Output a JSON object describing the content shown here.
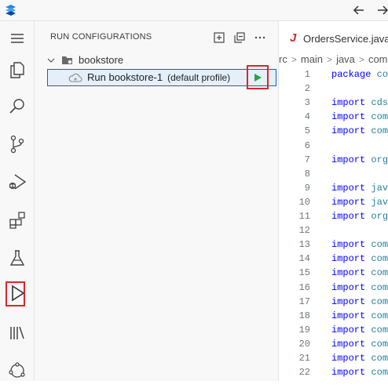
{
  "sidebar": {
    "title": "RUN CONFIGURATIONS",
    "group_label": "bookstore",
    "config_name": "Run bookstore-1",
    "config_profile": "(default profile)"
  },
  "editor": {
    "tab_icon": "J",
    "tab_label": "OrdersService.java",
    "breadcrumb": [
      "rc",
      "main",
      "java",
      "com"
    ],
    "lines": [
      {
        "num": "1",
        "kw": "package",
        "rest": "co"
      },
      {
        "num": "2",
        "kw": "",
        "rest": ""
      },
      {
        "num": "3",
        "kw": "import",
        "rest": "cds"
      },
      {
        "num": "4",
        "kw": "import",
        "rest": "com"
      },
      {
        "num": "5",
        "kw": "import",
        "rest": "com"
      },
      {
        "num": "6",
        "kw": "",
        "rest": ""
      },
      {
        "num": "7",
        "kw": "import",
        "rest": "org"
      },
      {
        "num": "8",
        "kw": "",
        "rest": ""
      },
      {
        "num": "9",
        "kw": "import",
        "rest": "jav"
      },
      {
        "num": "10",
        "kw": "import",
        "rest": "jav"
      },
      {
        "num": "11",
        "kw": "import",
        "rest": "org"
      },
      {
        "num": "12",
        "kw": "",
        "rest": ""
      },
      {
        "num": "13",
        "kw": "import",
        "rest": "com"
      },
      {
        "num": "14",
        "kw": "import",
        "rest": "com"
      },
      {
        "num": "15",
        "kw": "import",
        "rest": "com"
      },
      {
        "num": "16",
        "kw": "import",
        "rest": "com"
      },
      {
        "num": "17",
        "kw": "import",
        "rest": "com"
      },
      {
        "num": "18",
        "kw": "import",
        "rest": "com"
      },
      {
        "num": "19",
        "kw": "import",
        "rest": "com"
      },
      {
        "num": "20",
        "kw": "import",
        "rest": "com"
      },
      {
        "num": "21",
        "kw": "import",
        "rest": "com"
      },
      {
        "num": "22",
        "kw": "import",
        "rest": "com"
      }
    ]
  },
  "icons": {
    "accent": "#0a66c2",
    "highlight": "#d9262d",
    "play": "#2ea043"
  }
}
